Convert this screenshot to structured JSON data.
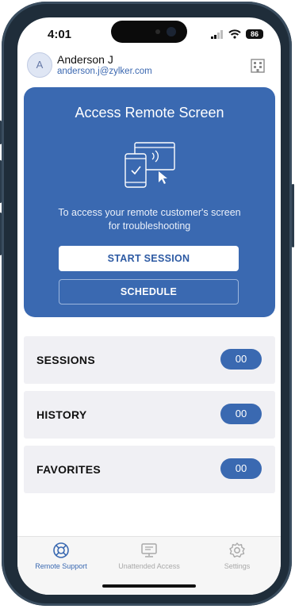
{
  "status": {
    "time": "4:01",
    "battery": "86"
  },
  "user": {
    "initial": "A",
    "name": "Anderson J",
    "email": "anderson.j@zylker.com"
  },
  "access_card": {
    "title": "Access Remote Screen",
    "description": "To access your remote customer's screen for troubleshooting",
    "start_label": "START SESSION",
    "schedule_label": "SCHEDULE"
  },
  "lists": [
    {
      "label": "SESSIONS",
      "count": "00"
    },
    {
      "label": "HISTORY",
      "count": "00"
    },
    {
      "label": "FAVORITES",
      "count": "00"
    }
  ],
  "tabs": [
    {
      "label": "Remote Support",
      "icon": "lifebuoy-icon",
      "active": true
    },
    {
      "label": "Unattended Access",
      "icon": "unattended-access-icon",
      "active": false
    },
    {
      "label": "Settings",
      "icon": "gear-icon",
      "active": false
    }
  ],
  "colors": {
    "brand": "#3a69b1",
    "tab_active": "#3a69b1",
    "tab_inactive": "#a9a9a9"
  }
}
